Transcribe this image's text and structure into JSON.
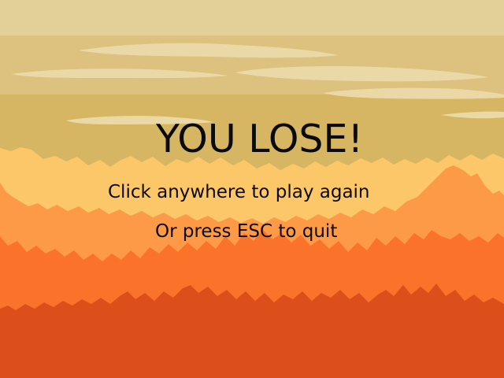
{
  "game_over_screen": {
    "title": "YOU LOSE!",
    "play_again_hint": "Click anywhere to play again",
    "quit_hint": "Or press ESC to quit"
  },
  "palette": {
    "sky_top": "#e3cf98",
    "sky_band": "#dcc17f",
    "sky_low": "#d6b662",
    "cloud": "#ead9a6",
    "mountain_far": "#fcc769",
    "mountain_mid": "#fc9a47",
    "mountain_near": "#fb732a",
    "mountain_front": "#dd4f1a",
    "text": "#0a0a0a"
  }
}
